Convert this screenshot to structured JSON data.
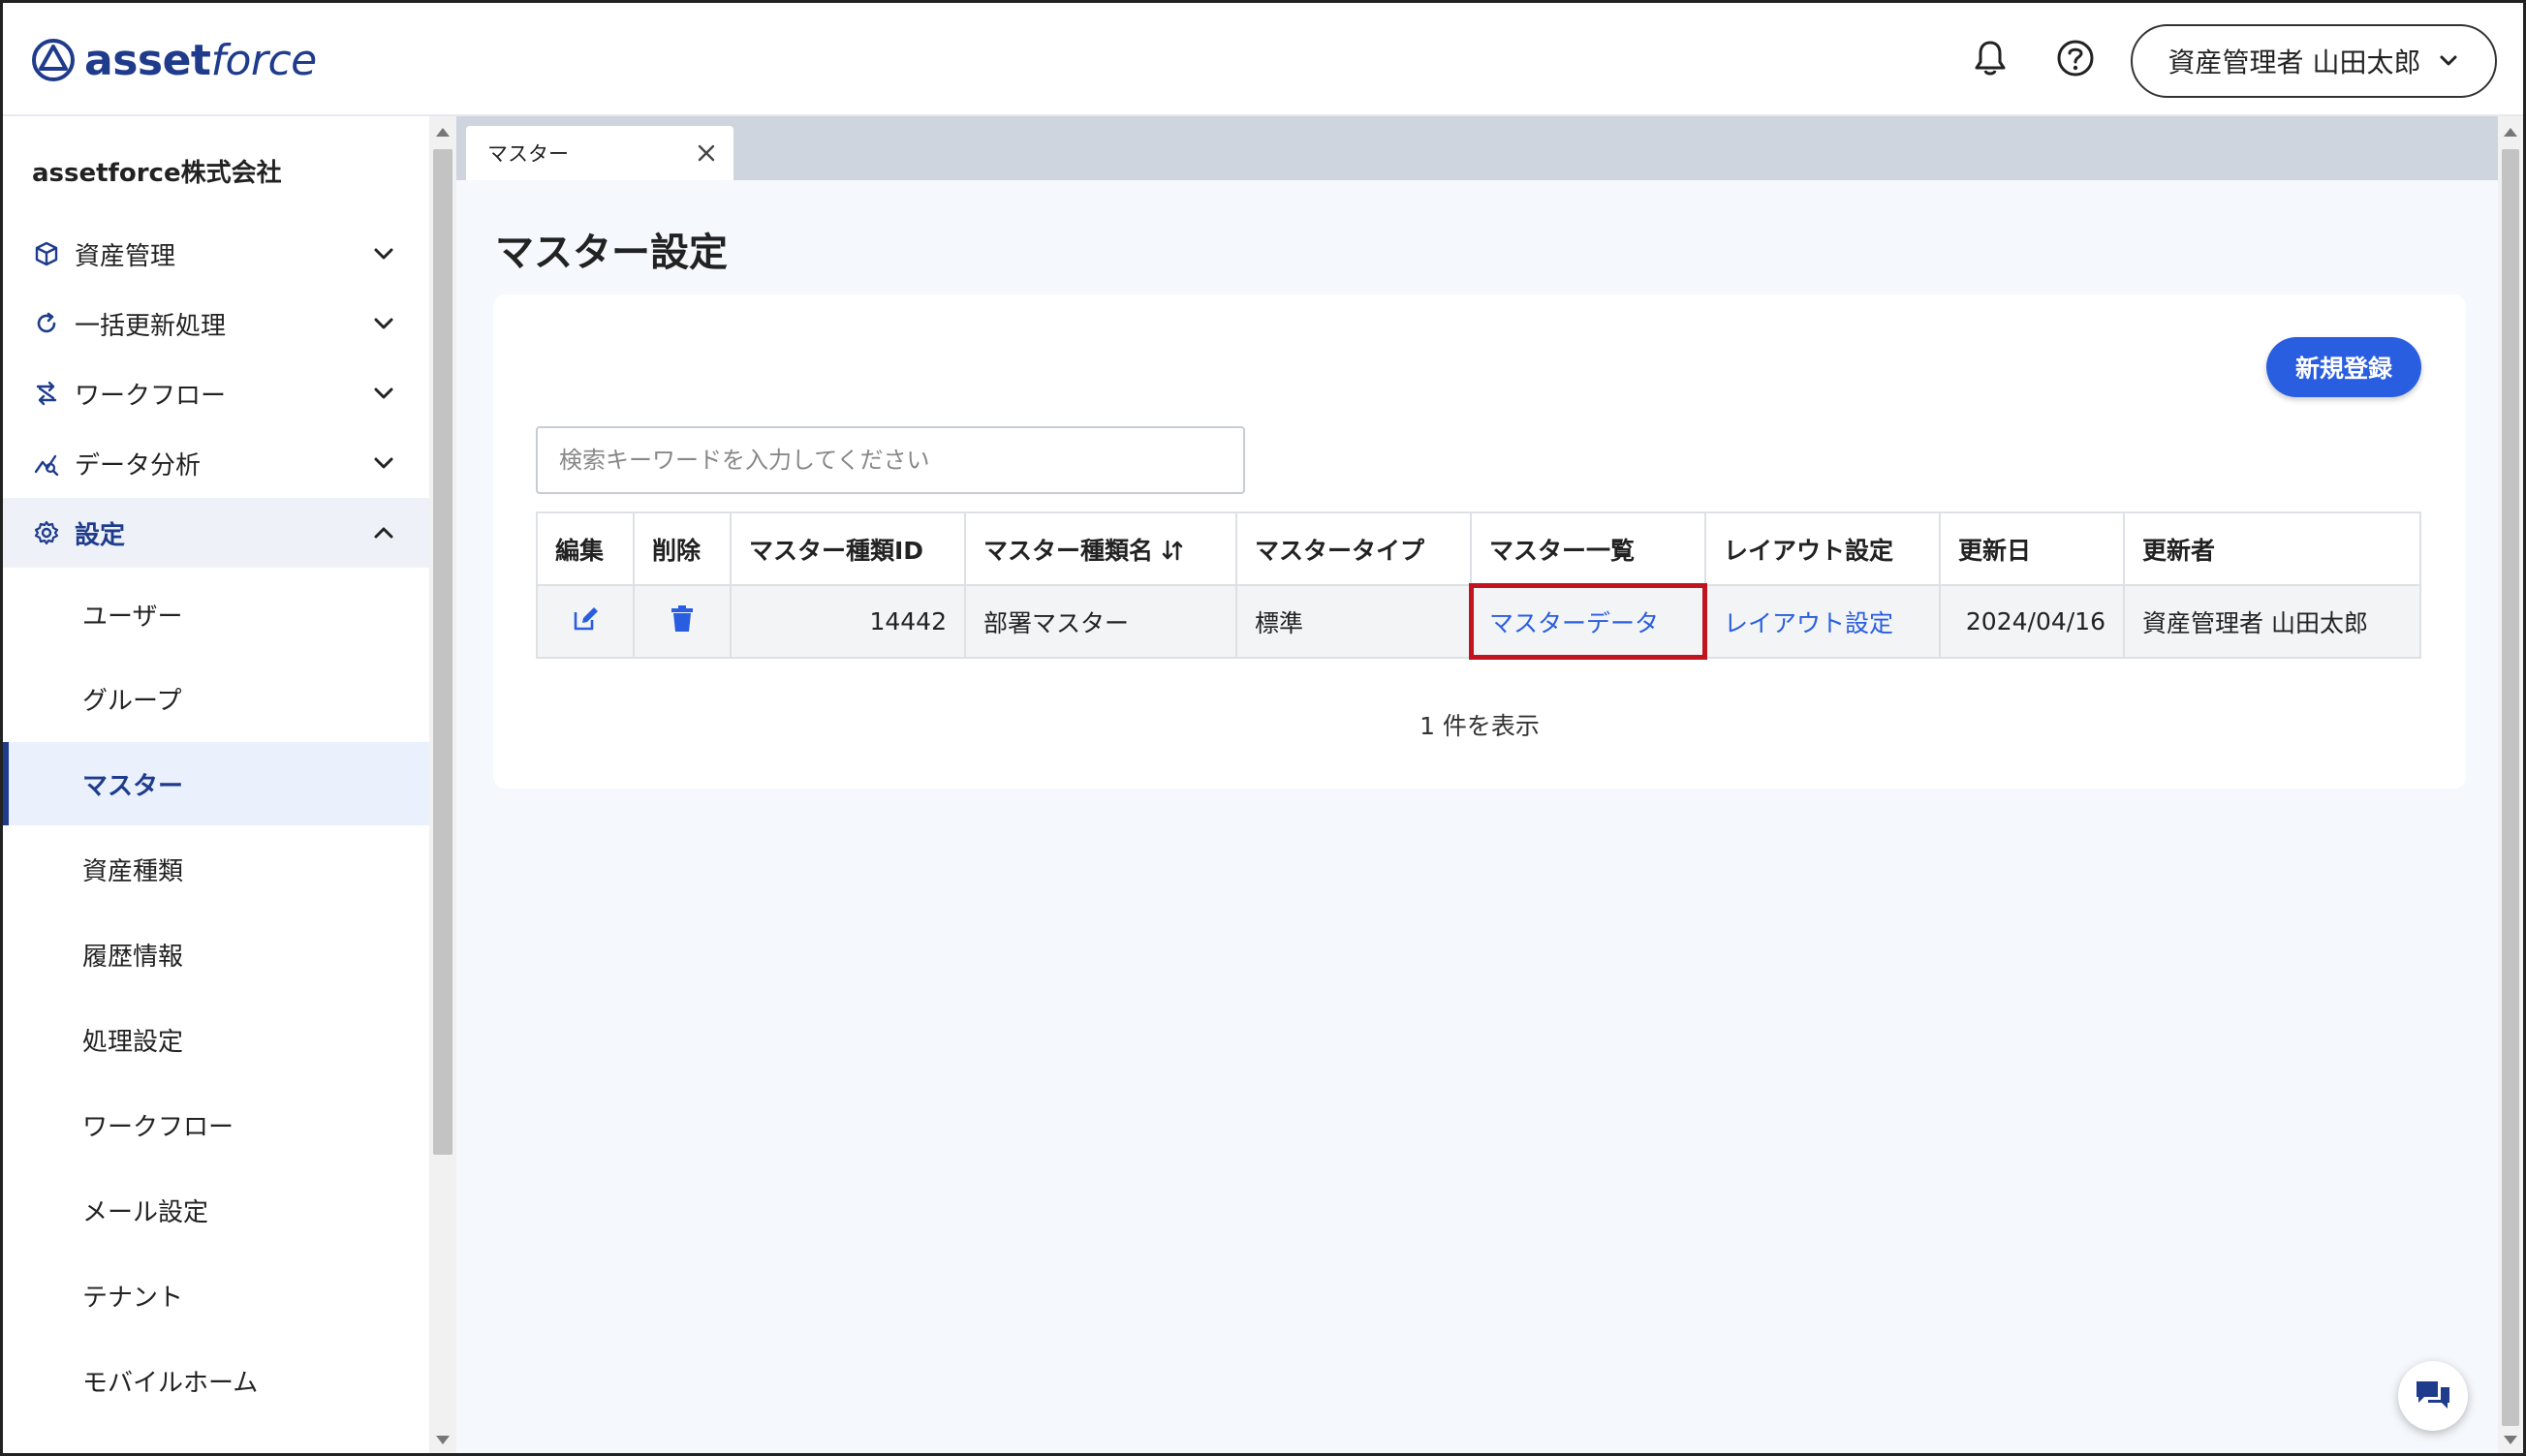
{
  "header": {
    "logo_text_bold": "asset",
    "logo_text_italic": "force",
    "user_menu_label": "資産管理者 山田太郎"
  },
  "sidebar": {
    "company": "assetforce株式会社",
    "nav": [
      {
        "label": "資産管理",
        "icon": "cube-icon"
      },
      {
        "label": "一括更新処理",
        "icon": "refresh-icon"
      },
      {
        "label": "ワークフロー",
        "icon": "workflow-icon"
      },
      {
        "label": "データ分析",
        "icon": "analytics-icon"
      },
      {
        "label": "設定",
        "icon": "gear-icon"
      }
    ],
    "sub_items": [
      "ユーザー",
      "グループ",
      "マスター",
      "資産種類",
      "履歴情報",
      "処理設定",
      "ワークフロー",
      "メール設定",
      "テナント",
      "モバイルホーム"
    ]
  },
  "tabs": [
    {
      "label": "マスター"
    }
  ],
  "page": {
    "title": "マスター設定",
    "new_button": "新規登録",
    "search_placeholder": "検索キーワードを入力してください",
    "result_count": "1 件を表示"
  },
  "table": {
    "headers": [
      "編集",
      "削除",
      "マスター種類ID",
      "マスター種類名",
      "マスタータイプ",
      "マスター一覧",
      "レイアウト設定",
      "更新日",
      "更新者"
    ],
    "rows": [
      {
        "id": "14442",
        "name": "部署マスター",
        "type": "標準",
        "list_link": "マスターデータ",
        "layout_link": "レイアウト設定",
        "updated": "2024/04/16",
        "updater": "資産管理者 山田太郎"
      }
    ]
  },
  "colors": {
    "brand": "#1f3c8c",
    "accent": "#2a5ee0",
    "highlight": "#c0141e"
  }
}
